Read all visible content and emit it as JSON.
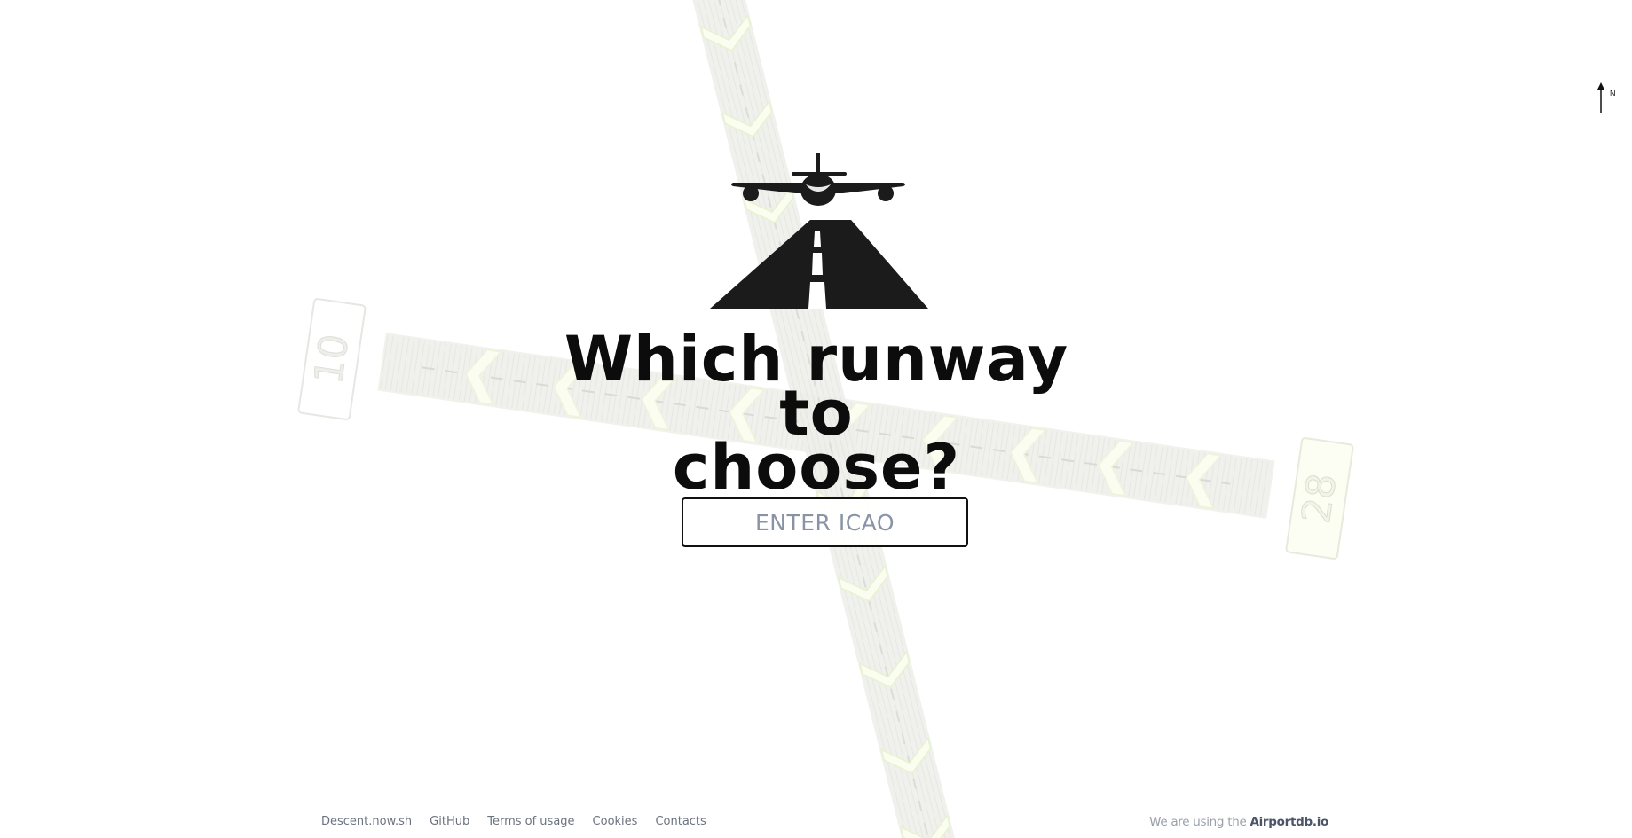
{
  "runway": {
    "end_a": "10",
    "end_b": "28",
    "surface_color": "#ebece8",
    "edge_color": "#f3f4ef",
    "chevron_color": "#fbfdf0",
    "chevron_accent": "#e6f3cf"
  },
  "compass": {
    "label": "N",
    "icon": "north-arrow-icon"
  },
  "logo": {
    "icon": "airplane-landing-runway-icon",
    "color": "#1b1b1b"
  },
  "headline": {
    "line1": "Which runway to",
    "line2": "choose?"
  },
  "search": {
    "placeholder": "ENTER ICAO",
    "value": ""
  },
  "footer": {
    "links": [
      {
        "label": "Descent.now.sh"
      },
      {
        "label": "GitHub"
      },
      {
        "label": "Terms of usage"
      },
      {
        "label": "Cookies"
      },
      {
        "label": "Contacts"
      }
    ],
    "credit_prefix": "We are using the ",
    "credit_link": "Airportdb.io"
  }
}
